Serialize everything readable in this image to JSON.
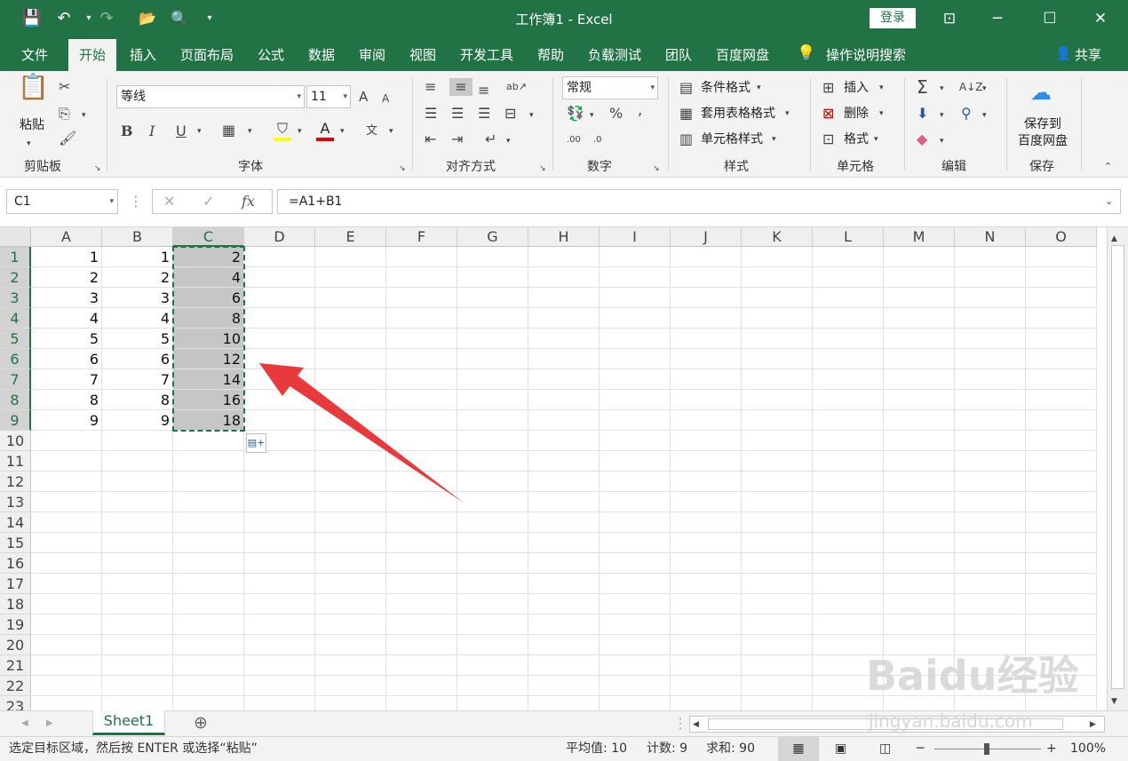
{
  "window": {
    "title": "工作簿1  -  Excel",
    "login": "登录"
  },
  "qat": {
    "save": "💾",
    "undo": "↶",
    "redo": "↷",
    "open": "📂",
    "preview": "🔍"
  },
  "menu": {
    "tabs": [
      "文件",
      "开始",
      "插入",
      "页面布局",
      "公式",
      "数据",
      "审阅",
      "视图",
      "开发工具",
      "帮助",
      "负载测试",
      "团队",
      "百度网盘"
    ],
    "active": "开始",
    "search": "操作说明搜索",
    "share": "共享"
  },
  "ribbon": {
    "clipboard": {
      "paste": "粘贴",
      "label": "剪贴板"
    },
    "font": {
      "name": "等线",
      "size": "11",
      "bold": "B",
      "italic": "I",
      "underline": "U",
      "label": "字体",
      "grow": "A",
      "shrink": "A",
      "phonetic": "文"
    },
    "align": {
      "label": "对齐方式"
    },
    "number": {
      "format": "常规",
      "percent": "%",
      "comma": ",",
      "label": "数字",
      "inc": ".00",
      "dec": ".0"
    },
    "styles": {
      "cond": "条件格式",
      "table": "套用表格格式",
      "cell": "单元格样式",
      "label": "样式"
    },
    "cells": {
      "insert": "插入",
      "delete": "删除",
      "format": "格式",
      "label": "单元格"
    },
    "edit": {
      "sum": "Σ",
      "label": "编辑"
    },
    "save": {
      "btn1": "保存到",
      "btn2": "百度网盘",
      "label": "保存"
    }
  },
  "formula_bar": {
    "name_box": "C1",
    "fx": "fx",
    "formula": "=A1+B1"
  },
  "grid": {
    "columns": [
      "A",
      "B",
      "C",
      "D",
      "E",
      "F",
      "G",
      "H",
      "I",
      "J",
      "K",
      "L",
      "M",
      "N",
      "O"
    ],
    "selected_col": "C",
    "rows": [
      "1",
      "2",
      "3",
      "4",
      "5",
      "6",
      "7",
      "8",
      "9",
      "10",
      "11",
      "12",
      "13",
      "14",
      "15",
      "16",
      "17",
      "18",
      "19",
      "20",
      "21",
      "22",
      "23"
    ],
    "data": [
      [
        "1",
        "1",
        "2"
      ],
      [
        "2",
        "2",
        "4"
      ],
      [
        "3",
        "3",
        "6"
      ],
      [
        "4",
        "4",
        "8"
      ],
      [
        "5",
        "5",
        "10"
      ],
      [
        "6",
        "6",
        "12"
      ],
      [
        "7",
        "7",
        "14"
      ],
      [
        "8",
        "8",
        "16"
      ],
      [
        "9",
        "9",
        "18"
      ]
    ]
  },
  "sheets": {
    "tabs": [
      "Sheet1"
    ],
    "add": "⊕"
  },
  "status": {
    "message": "选定目标区域，然后按 ENTER 或选择“粘贴”",
    "average": "平均值: 10",
    "count": "计数: 9",
    "sum": "求和: 90",
    "zoom": "100%"
  },
  "watermark": {
    "brand": "Baidu经验",
    "url": "jingyan.baidu.com"
  },
  "colors": {
    "accent": "#217346",
    "arrow": "#e8393c"
  }
}
